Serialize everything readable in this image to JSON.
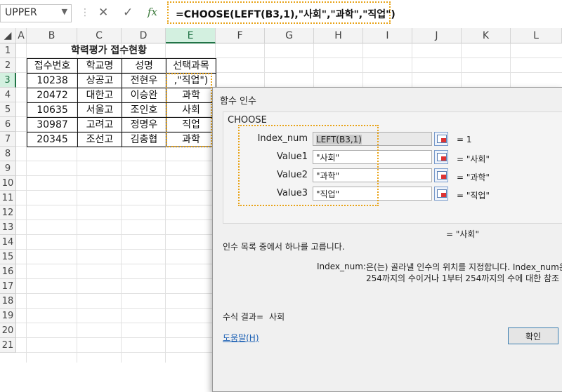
{
  "formula_bar": {
    "name_box": "UPPER",
    "cancel_icon": "✕",
    "enter_icon": "✓",
    "fx_label": "fx",
    "formula": "=CHOOSE(LEFT(B3,1),\"사회\",\"과학\",\"직업\")"
  },
  "columns": [
    "A",
    "B",
    "C",
    "D",
    "E",
    "F",
    "G",
    "H",
    "I",
    "J",
    "K",
    "L"
  ],
  "rows": [
    "1",
    "2",
    "3",
    "4",
    "5",
    "6",
    "7",
    "8",
    "9",
    "10",
    "11",
    "12",
    "13",
    "14",
    "15",
    "16",
    "17",
    "18",
    "19",
    "20",
    "21"
  ],
  "sheet": {
    "title": "학력평가 접수현황",
    "headers": [
      "접수번호",
      "학교명",
      "성명",
      "선택과목"
    ],
    "data": [
      [
        "10238",
        "상공고",
        "전현우",
        ",\"직업\")"
      ],
      [
        "20472",
        "대한고",
        "이승완",
        "과학"
      ],
      [
        "10635",
        "서울고",
        "조인호",
        "사회"
      ],
      [
        "30987",
        "고려고",
        "정명우",
        "직업"
      ],
      [
        "20345",
        "조선고",
        "김충협",
        "과학"
      ]
    ]
  },
  "dialog": {
    "title": "함수 인수",
    "function_name": "CHOOSE",
    "args": [
      {
        "label": "Index_num",
        "value": "LEFT(B3,1)",
        "result": "= 1"
      },
      {
        "label": "Value1",
        "value": "\"사회\"",
        "result": "= \"사회\""
      },
      {
        "label": "Value2",
        "value": "\"과학\"",
        "result": "= \"과학\""
      },
      {
        "label": "Value3",
        "value": "\"직업\"",
        "result": "= \"직업\""
      }
    ],
    "final_result": "= \"사회\"",
    "description": "인수 목록 중에서 하나를 고릅니다.",
    "arg_name": "Index_num:",
    "arg_desc_line1": "은(는) 골라낼 인수의 위치를 지정합니다. Index_num은",
    "arg_desc_line2": "254까지의 수이거나 1부터 254까지의 수에 대한 참조",
    "formula_result_label": "수식 결과=",
    "formula_result_value": "사회",
    "help_link": "도움말(H)",
    "ok_button": "확인"
  }
}
